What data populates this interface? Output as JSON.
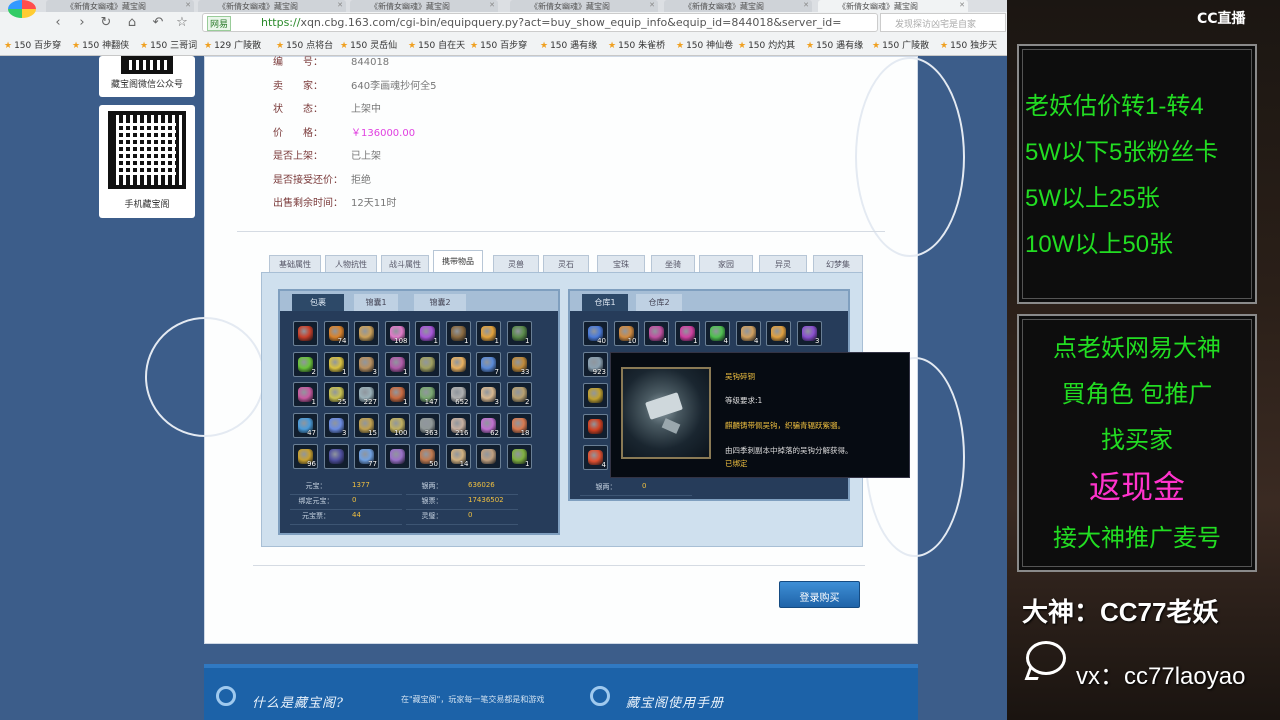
{
  "browser": {
    "tabs": [
      "《新倩女幽魂》藏宝阁",
      "《新倩女幽魂》藏宝阁",
      "《新倩女幽魂》藏宝阁",
      "《新倩女幽魂》藏宝阁",
      "《新倩女幽魂》藏宝阁",
      "《新倩女幽魂》藏宝阁"
    ],
    "url_prefix": "https://",
    "url": "xqn.cbg.163.com/cgi-bin/equipquery.py?act=buy_show_equip_info&equip_id=844018&server_id=",
    "secure_label": "网易",
    "search_placeholder": "发现探访凶宅是自家",
    "bookmarks": [
      "150 百步穿",
      "150 神翻侠",
      "150 三哥词",
      "129 广陵散",
      "150 点将台",
      "150 灵岳仙",
      "150 自在天",
      "150 百步穿",
      "150 遇有缘",
      "150 朱雀桥",
      "150 神仙卷",
      "150 灼灼其",
      "150 遇有缘",
      "150 广陵散",
      "150 独步天"
    ]
  },
  "sidebar": {
    "qr1_label": "藏宝阁微信公众号",
    "qr2_label": "手机藏宝阁"
  },
  "info": [
    {
      "label": "编　　号：",
      "value": "844018"
    },
    {
      "label": "卖　　家：",
      "value": "640李画魂抄何全5"
    },
    {
      "label": "状　　态：",
      "value": "上架中"
    },
    {
      "label": "价　　格：",
      "value": "￥136000.00"
    },
    {
      "label": "是否上架：",
      "value": "已上架"
    },
    {
      "label": "是否接受还价：",
      "value": "拒绝"
    },
    {
      "label": "出售剩余时间：",
      "value": "12天11时"
    }
  ],
  "char_tabs": [
    "基础属性",
    "人物抗性",
    "战斗属性",
    "携带物品",
    "灵兽",
    "灵石",
    "宝珠",
    "坐骑",
    "家园",
    "异灵",
    "幻梦集"
  ],
  "active_char_tab": "携带物品",
  "bag": {
    "tabs": [
      "包裹",
      "锦囊1",
      "锦囊2"
    ],
    "active_tab": "包裹",
    "items": [
      {
        "color": "#c8402a",
        "count": ""
      },
      {
        "color": "#d9822b",
        "count": "74"
      },
      {
        "color": "#caa05a",
        "count": ""
      },
      {
        "color": "#e07ac8",
        "count": "108"
      },
      {
        "color": "#a855d8",
        "count": "1"
      },
      {
        "color": "#8a6a40",
        "count": "1"
      },
      {
        "color": "#e2a23c",
        "count": "1"
      },
      {
        "color": "#5a8a4a",
        "count": "1"
      },
      {
        "color": "#6ac23a",
        "count": "2"
      },
      {
        "color": "#d8c040",
        "count": "1"
      },
      {
        "color": "#b89060",
        "count": "3"
      },
      {
        "color": "#b05aa8",
        "count": "1"
      },
      {
        "color": "#a0a060",
        "count": ""
      },
      {
        "color": "#e8b060",
        "count": ""
      },
      {
        "color": "#5a8ad8",
        "count": "7"
      },
      {
        "color": "#c08a3a",
        "count": "33"
      },
      {
        "color": "#c85aa0",
        "count": "1"
      },
      {
        "color": "#c8c050",
        "count": "25"
      },
      {
        "color": "#9ab0b8",
        "count": "227"
      },
      {
        "color": "#c86a40",
        "count": "1"
      },
      {
        "color": "#7aa870",
        "count": "147"
      },
      {
        "color": "#b0b0b0",
        "count": "652"
      },
      {
        "color": "#d8b890",
        "count": "3"
      },
      {
        "color": "#b8a070",
        "count": "2"
      },
      {
        "color": "#4a9ad8",
        "count": "47"
      },
      {
        "color": "#6a8ae0",
        "count": "3"
      },
      {
        "color": "#c0a050",
        "count": "15"
      },
      {
        "color": "#c0b060",
        "count": "100"
      },
      {
        "color": "#909898",
        "count": "363"
      },
      {
        "color": "#c8b0a0",
        "count": "216"
      },
      {
        "color": "#c070d0",
        "count": "62"
      },
      {
        "color": "#d87a50",
        "count": "18"
      },
      {
        "color": "#c8a030",
        "count": "96"
      },
      {
        "color": "#5050a0",
        "count": ""
      },
      {
        "color": "#70a0e0",
        "count": "77"
      },
      {
        "color": "#9a70c8",
        "count": ""
      },
      {
        "color": "#c07a50",
        "count": "50"
      },
      {
        "color": "#d0b080",
        "count": "14"
      },
      {
        "color": "#c0a080",
        "count": ""
      },
      {
        "color": "#80b040",
        "count": "1"
      }
    ],
    "stats": [
      {
        "label": "元宝：",
        "value": "1377"
      },
      {
        "label": "银两：",
        "value": "636026"
      },
      {
        "label": "绑定元宝：",
        "value": "0"
      },
      {
        "label": "银票：",
        "value": "17436502"
      },
      {
        "label": "元宝票：",
        "value": "44"
      },
      {
        "label": "灵璧：",
        "value": "0"
      }
    ]
  },
  "warehouse": {
    "tabs": [
      "仓库1",
      "仓库2"
    ],
    "active_tab": "仓库1",
    "items": [
      {
        "color": "#4a7ad8",
        "count": "40"
      },
      {
        "color": "#d08a40",
        "count": "10"
      },
      {
        "color": "#c050a0",
        "count": "4"
      },
      {
        "color": "#d040a0",
        "count": "1"
      },
      {
        "color": "#50c050",
        "count": "4"
      },
      {
        "color": "#d0a060",
        "count": "4"
      },
      {
        "color": "#e0a040",
        "count": "4"
      },
      {
        "color": "#8a50d0",
        "count": "3"
      },
      {
        "color": "#8aa0b0",
        "count": "923"
      },
      {
        "color": "#c0a030",
        "count": ""
      },
      {
        "color": "#d04020",
        "count": ""
      },
      {
        "color": "#e05030",
        "count": "4"
      }
    ],
    "stats": [
      {
        "label": "银两：",
        "value": "0"
      }
    ]
  },
  "tooltip": {
    "name": "吴钩碎铜",
    "level_req": "等级要求:1",
    "desc": "麒麟铸带佩吴钩，织骗青辐跃紫骝。",
    "source": "由四季刺副本中掉落的吴钩分解获得。",
    "bound": "已绑定"
  },
  "buy_button": "登录购买",
  "footer": {
    "what_title": "什么是藏宝阁?",
    "what_desc": "在\"藏宝阁\"，玩家每一笔交易都是和游戏",
    "manual_title": "藏宝阁使用手册"
  },
  "stream": {
    "cc_logo": "CC直播",
    "box1_lines": [
      "老妖估价转1-转4",
      "5W以下5张粉丝卡",
      "5W以上25张",
      "10W以上50张"
    ],
    "box2_lines": [
      "点老妖网易大神",
      "買角色 包推广",
      "找买家",
      "返现金",
      "接大神推广麦号"
    ],
    "promo1": "大神：CC77老妖",
    "promo2": "vx：cc77laoyao",
    "text_green": "#22dd22",
    "text_magenta": "#ff33cc"
  }
}
